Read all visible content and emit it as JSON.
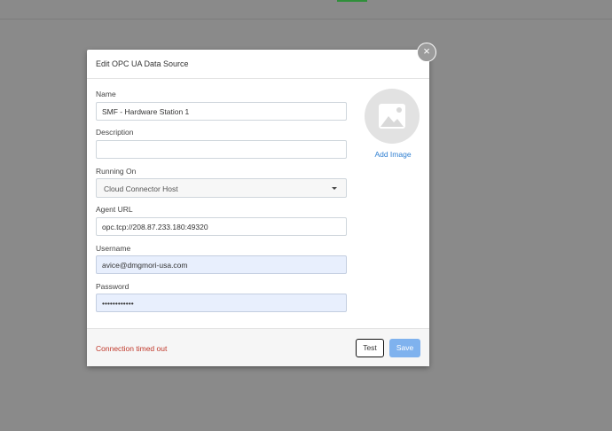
{
  "modal": {
    "title": "Edit OPC UA Data Source",
    "close_glyph": "×"
  },
  "form": {
    "name": {
      "label": "Name",
      "value": "SMF - Hardware Station 1"
    },
    "description": {
      "label": "Description",
      "value": ""
    },
    "running_on": {
      "label": "Running On",
      "value": "Cloud Connector Host"
    },
    "agent_url": {
      "label": "Agent URL",
      "value": "opc.tcp://208.87.233.180:49320"
    },
    "username": {
      "label": "Username",
      "value": "avice@dmgmori-usa.com"
    },
    "password": {
      "label": "Password",
      "value": "••••••••••••"
    }
  },
  "image": {
    "add_label": "Add Image",
    "icon": "image-icon"
  },
  "footer": {
    "status": "Connection timed out",
    "test_label": "Test",
    "save_label": "Save"
  },
  "colors": {
    "error": "#c0392b",
    "link": "#2f7fd1",
    "primary_disabled": "#7fb2ee",
    "autofill": "#e8effd"
  }
}
